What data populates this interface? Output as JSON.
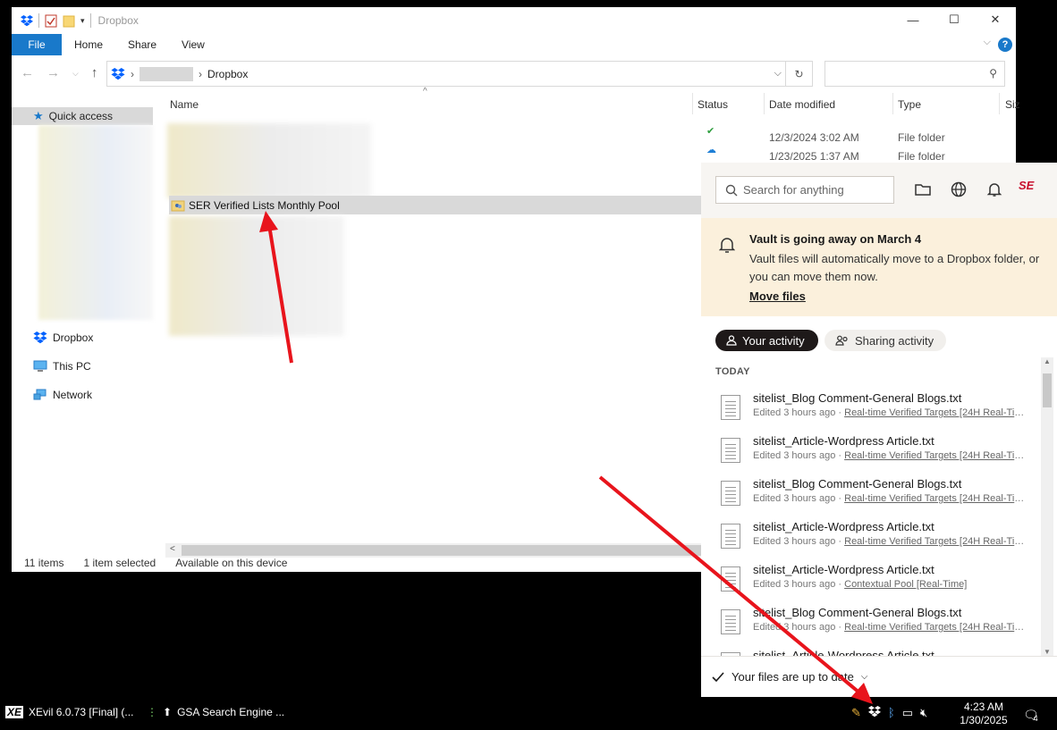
{
  "explorer": {
    "title": "Dropbox",
    "ribbon_tabs": [
      "File",
      "Home",
      "Share",
      "View"
    ],
    "help_label": "?",
    "address": {
      "crumb": "Dropbox"
    },
    "sidebar": {
      "quick_access": "Quick access",
      "dropbox": "Dropbox",
      "this_pc": "This PC",
      "network": "Network"
    },
    "columns": {
      "name": "Name",
      "status": "Status",
      "date": "Date modified",
      "type": "Type",
      "size": "Siz"
    },
    "selected_file": "SER Verified Lists Monthly Pool",
    "rows": [
      {
        "date": "12/3/2024 3:02 AM",
        "type": "File folder"
      },
      {
        "date": "1/23/2025 1:37 AM",
        "type": "File folder"
      }
    ],
    "status_icons": [
      "ok",
      "cloud",
      "ok",
      "cloud",
      "ok",
      "ok",
      "ok",
      "cloud",
      "cloud",
      "ok",
      "ok"
    ],
    "statusbar": {
      "items": "11 items",
      "selected": "1 item selected",
      "availability": "Available on this device"
    }
  },
  "dropbox_panel": {
    "search_placeholder": "Search for anything",
    "avatar_text": "SE",
    "banner": {
      "title": "Vault is going away on March 4",
      "body": "Vault files will automatically move to a Dropbox folder, or you can move them now.",
      "link": "Move files"
    },
    "tabs": {
      "your_activity": "Your activity",
      "sharing_activity": "Sharing activity"
    },
    "section": "TODAY",
    "activity": [
      {
        "name": "sitelist_Blog Comment-General Blogs.txt",
        "edited": "Edited 3 hours ago · ",
        "location": "Real-time Verified Targets [24H Real-Time..."
      },
      {
        "name": "sitelist_Article-Wordpress Article.txt",
        "edited": "Edited 3 hours ago · ",
        "location": "Real-time Verified Targets [24H Real-Time..."
      },
      {
        "name": "sitelist_Blog Comment-General Blogs.txt",
        "edited": "Edited 3 hours ago · ",
        "location": "Real-time Verified Targets [24H Real-Time..."
      },
      {
        "name": "sitelist_Article-Wordpress Article.txt",
        "edited": "Edited 3 hours ago · ",
        "location": "Real-time Verified Targets [24H Real-Time..."
      },
      {
        "name": "sitelist_Article-Wordpress Article.txt",
        "edited": "Edited 3 hours ago · ",
        "location": "Contextual Pool [Real-Time]"
      },
      {
        "name": "sitelist_Blog Comment-General Blogs.txt",
        "edited": "Edited 3 hours ago · ",
        "location": "Real-time Verified Targets [24H Real-Time..."
      },
      {
        "name": "sitelist_Article-Wordpress Article.txt",
        "edited": "",
        "location": ""
      }
    ],
    "footer": "Your files are up to date"
  },
  "taskbar": {
    "app1": "XEvil 6.0.73 [Final] (...",
    "app1_icon_text": "XE",
    "app2": "GSA Search Engine ...",
    "time": "4:23 AM",
    "date": "1/30/2025",
    "notification_count": "4"
  },
  "colors": {
    "accent": "#1979ca",
    "arrow": "#e8141c",
    "ok": "#2e9e3e",
    "cloud": "#1e7fd6",
    "banner": "#fbf0dc"
  }
}
